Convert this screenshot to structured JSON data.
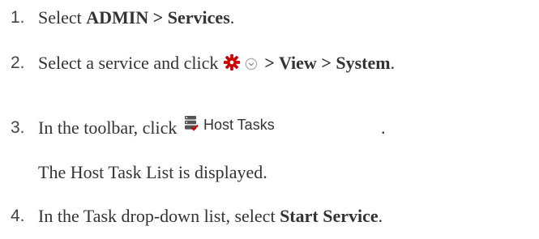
{
  "steps": [
    {
      "number": "1.",
      "text_before": "Select ",
      "bold": "ADMIN > Services",
      "text_after": "."
    },
    {
      "number": "2.",
      "text_before": "Select a service and click",
      "icons": [
        "gear-icon",
        "chevron-down-circle-icon"
      ],
      "bold": "> View > System",
      "text_after": "."
    },
    {
      "number": "3.",
      "text_before": "In the toolbar, click",
      "button_label": "Host Tasks",
      "button_icon": "host-tasks-icon",
      "text_after": ".",
      "sub_text": "The Host Task List is displayed."
    },
    {
      "number": "4.",
      "text_before": "In the Task drop-down list, select ",
      "bold": "Start Service",
      "text_after": "."
    }
  ],
  "colors": {
    "text": "#333333",
    "gear": "#cc0000",
    "chevron": "#aaaaaa",
    "host_icon": "#555555"
  }
}
